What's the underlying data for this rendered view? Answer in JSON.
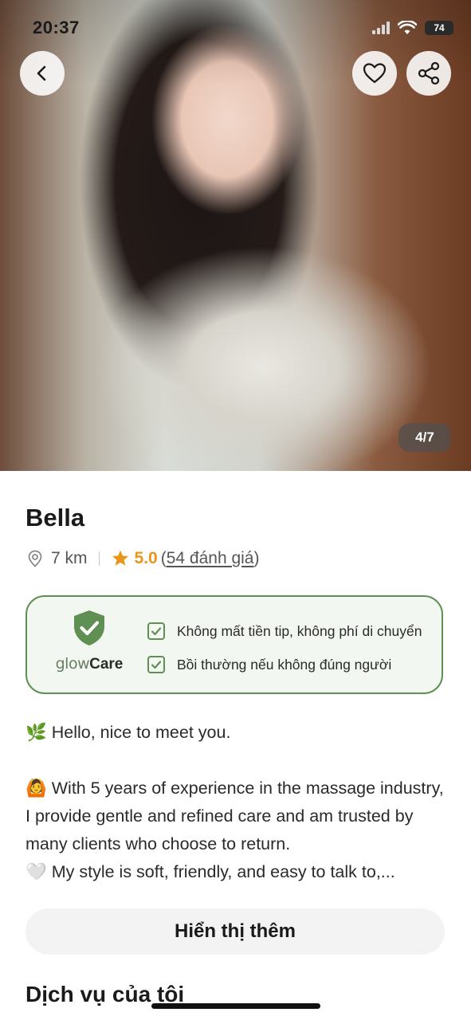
{
  "status_bar": {
    "time": "20:37",
    "battery": "74"
  },
  "gallery": {
    "counter": "4/7"
  },
  "icons": {
    "back": "chevron-left-icon",
    "favorite": "heart-icon",
    "share": "share-icon",
    "location": "location-pin-icon",
    "rating": "star-icon",
    "shield": "shield-check-icon",
    "check": "checkbox-check-icon"
  },
  "profile": {
    "name": "Bella",
    "distance": "7 km",
    "rating": "5.0",
    "reviews_open": "(",
    "reviews_link": "54 đánh giá",
    "reviews_close": ")"
  },
  "glow_care": {
    "brand_glow": "glow",
    "brand_care": "Care",
    "benefits": [
      "Không mất tiền tip, không phí di chuyển",
      "Bồi thường nếu không đúng người"
    ]
  },
  "bio": {
    "lines": [
      "🌿 Hello, nice to meet you.",
      "🙆 With 5 years of experience in the massage industry, I provide gentle and refined care and am trusted by many clients who choose to return.",
      "🤍 My style is soft, friendly, and easy to talk to,..."
    ]
  },
  "show_more_label": "Hiển thị thêm",
  "services_title": "Dịch vụ của tôi",
  "colors": {
    "accent_green": "#5f8f52",
    "rating_orange": "#e8951b",
    "card_bg": "#f3f7f1"
  }
}
